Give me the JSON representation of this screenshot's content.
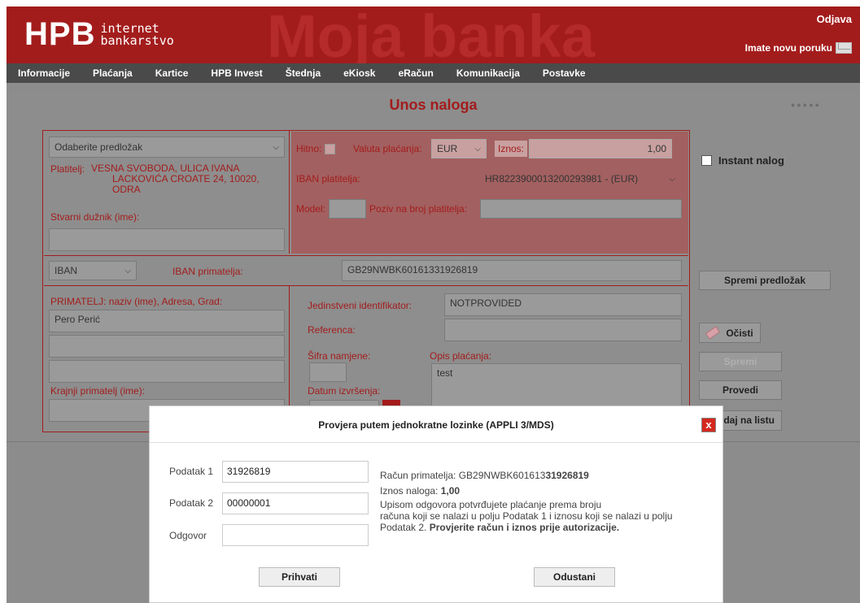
{
  "header": {
    "logo": "HPB",
    "logo_line1": "internet",
    "logo_line2": "bankarstvo",
    "watermark": "Moja banka",
    "logout": "Odjava",
    "new_message": "Imate novu poruku"
  },
  "nav": [
    "Informacije",
    "Plaćanja",
    "Kartice",
    "HPB Invest",
    "Štednja",
    "eKiosk",
    "eRačun",
    "Komunikacija",
    "Postavke"
  ],
  "page_title": "Unos naloga",
  "form": {
    "template_select": "Odaberite predložak",
    "payer_label": "Platitelj:",
    "payer_line1": "VESNA SVOBODA, ULICA IVANA",
    "payer_line2": "LACKOVIĆA CROATE 24, 10020,",
    "payer_line3": "ODRA",
    "actual_debtor_label": "Stvarni dužnik (ime):",
    "urgent_label": "Hitno:",
    "currency_label": "Valuta plaćanja:",
    "currency_value": "EUR",
    "amount_label": "Iznos:",
    "amount_value": "1,00",
    "payer_iban_label": "IBAN platitelja:",
    "payer_iban_value": "HR8223900013200293981 - (EUR)",
    "model_label": "Model:",
    "payer_reference_label": "Poziv na broj platitelja:",
    "account_type": "IBAN",
    "recipient_iban_label": "IBAN primatelja:",
    "recipient_iban_value": "GB29NWBK60161331926819",
    "recipient_label": "PRIMATELJ: naziv (ime), Adresa, Grad:",
    "recipient_name": "Pero Perić",
    "final_recipient_label": "Krajnji primatelj (ime):",
    "unique_id_label": "Jedinstveni identifikator:",
    "unique_id_value": "NOTPROVIDED",
    "reference_label": "Referenca:",
    "purpose_code_label": "Šifra namjene:",
    "description_label": "Opis plaćanja:",
    "description_value": "test",
    "execution_date_label": "Datum izvršenja:"
  },
  "side": {
    "instant_label": "Instant nalog",
    "save_template": "Spremi predložak",
    "clear": "Očisti",
    "save": "Spremi",
    "execute": "Provedi",
    "add_to_list": "daj na listu"
  },
  "modal": {
    "title": "Provjera putem jednokratne lozinke (APPLI 3/MDS)",
    "close": "x",
    "data1_label": "Podatak 1",
    "data1_value": "31926819",
    "data2_label": "Podatak 2",
    "data2_value": "00000001",
    "answer_label": "Odgovor",
    "account_label": "Račun primatelja:",
    "account_prefix": "GB29NWBK601613",
    "account_bold": "31926819",
    "amount_label": "Iznos naloga:",
    "amount_value": "1,00",
    "info_line1": "Upisom odgovora potvrđujete plaćanje prema broju",
    "info_line2": "računa koji se nalazi u polju Podatak 1 i iznosu koji se nalazi u polju",
    "info_line3": "Podatak 2.",
    "info_bold": "Provjerite račun i iznos prije autorizacije.",
    "accept": "Prihvati",
    "cancel": "Odustani"
  }
}
